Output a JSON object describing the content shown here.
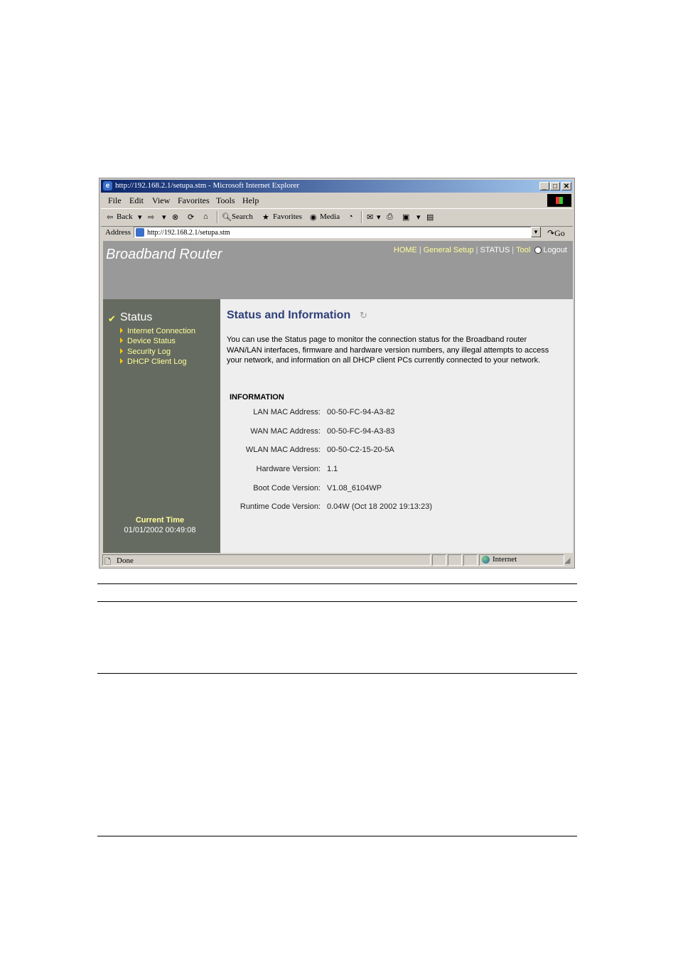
{
  "browser": {
    "title": "http://192.168.2.1/setupa.stm - Microsoft Internet Explorer",
    "window_buttons": {
      "minimize": "_",
      "maximize": "□",
      "close": "✕"
    },
    "menu": [
      "File",
      "Edit",
      "View",
      "Favorites",
      "Tools",
      "Help"
    ],
    "toolbar": {
      "back": "Back",
      "search": "Search",
      "favorites": "Favorites",
      "media": "Media"
    },
    "address_label": "Address",
    "address_url": "http://192.168.2.1/setupa.stm",
    "go_label": "Go",
    "status_text": "Done",
    "zone_text": "Internet"
  },
  "router": {
    "brand": "Broadband Router",
    "nav": {
      "home": "HOME",
      "general_setup": "General Setup",
      "status": "STATUS",
      "tool": "Tool",
      "logout": "Logout"
    },
    "sidebar": {
      "title": "Status",
      "items": [
        {
          "label": "Internet Connection"
        },
        {
          "label": "Device Status"
        },
        {
          "label": "Security Log"
        },
        {
          "label": "DHCP Client Log"
        }
      ],
      "current_time_label": "Current Time",
      "current_time_value": "01/01/2002 00:49:08"
    },
    "content": {
      "title": "Status and Information",
      "intro": "You can use the Status page to monitor the connection status for the Broadband router WAN/LAN interfaces, firmware and hardware version numbers, any illegal attempts to access your network, and information on all DHCP client PCs currently connected to your network.",
      "info_heading": "INFORMATION",
      "rows": [
        {
          "label": "LAN MAC Address:",
          "value": "00-50-FC-94-A3-82"
        },
        {
          "label": "WAN MAC Address:",
          "value": "00-50-FC-94-A3-83"
        },
        {
          "label": "WLAN MAC Address:",
          "value": "00-50-C2-15-20-5A"
        },
        {
          "label": "Hardware Version:",
          "value": "1.1"
        },
        {
          "label": "Boot Code Version:",
          "value": "V1.08_6104WP"
        },
        {
          "label": "Runtime Code Version:",
          "value": "0.04W (Oct 18 2002 19:13:23)"
        }
      ]
    }
  },
  "colors": {
    "header_bg": "#999999",
    "sidebar_bg": "#666b61",
    "content_bg": "#eeeeee",
    "title_color": "#2e3f7a",
    "link_color": "#ffff99"
  }
}
